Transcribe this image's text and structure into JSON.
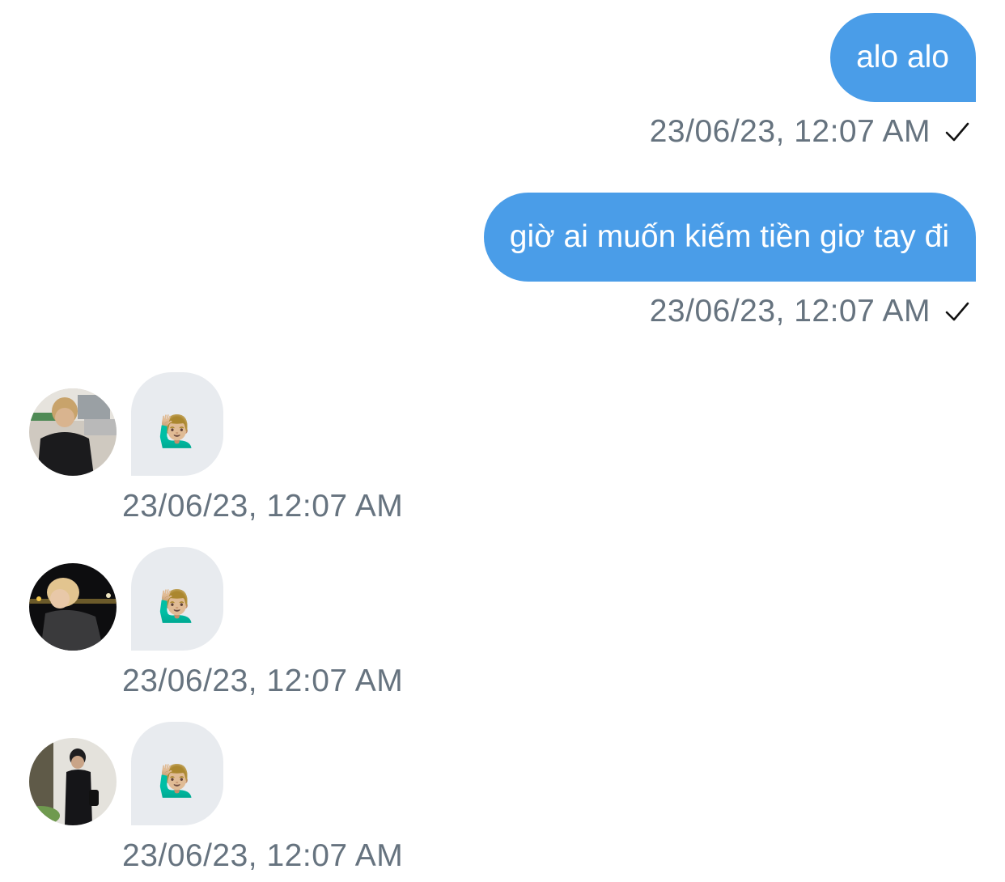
{
  "messages_out": [
    {
      "text": "alo alo",
      "time": "23/06/23, 12:07 AM",
      "status_icon": "check-icon"
    },
    {
      "text": "giờ ai muốn kiếm tiền giơ tay đi",
      "time": "23/06/23, 12:07 AM",
      "status_icon": "check-icon"
    }
  ],
  "messages_in": [
    {
      "emoji": "🙋🏼‍♂️",
      "time": "23/06/23, 12:07 AM",
      "avatar_icon": "user-avatar-photo"
    },
    {
      "emoji": "🙋🏼‍♂️",
      "time": "23/06/23, 12:07 AM",
      "avatar_icon": "user-avatar-photo"
    },
    {
      "emoji": "🙋🏼‍♂️",
      "time": "23/06/23, 12:07 AM",
      "avatar_icon": "user-avatar-photo"
    }
  ],
  "colors": {
    "outgoing_bubble": "#4a9de8",
    "incoming_bubble": "#e8ebef",
    "timestamp": "#66737f"
  }
}
